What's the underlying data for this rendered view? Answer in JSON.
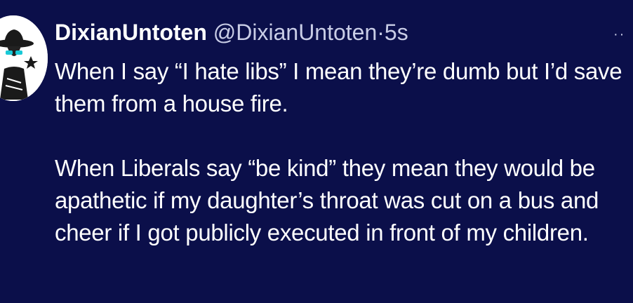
{
  "tweet": {
    "author": {
      "display_name": "DixianUntoten",
      "handle": "@DixianUntoten",
      "separator": "·",
      "time": "5s",
      "avatar_icon": "cowboy-avatar-icon"
    },
    "more_icon": "more-options-icon",
    "more_glyph": "··",
    "paragraphs": [
      "When I say “I hate libs” I mean they’re dumb but I’d save them from a house fire.",
      "When Liberals say “be kind” they mean they would be apathetic if my daughter’s throat was cut on a bus and cheer if I got publicly executed in front of my children."
    ]
  },
  "colors": {
    "background": "#0b0f4a",
    "text": "#ffffff",
    "secondary_text": "#c9cde6"
  }
}
